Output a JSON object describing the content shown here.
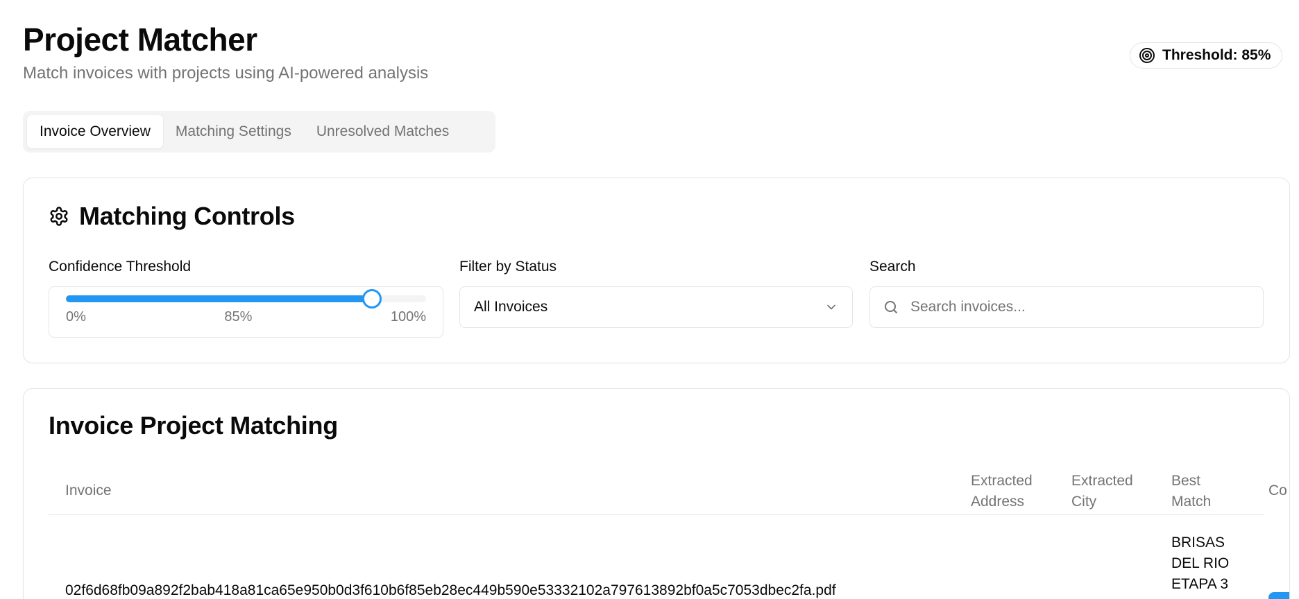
{
  "header": {
    "title": "Project Matcher",
    "subtitle": "Match invoices with projects using AI-powered analysis",
    "threshold_badge": "Threshold: 85%"
  },
  "tabs": [
    {
      "label": "Invoice Overview",
      "active": true
    },
    {
      "label": "Matching Settings",
      "active": false
    },
    {
      "label": "Unresolved Matches",
      "active": false
    }
  ],
  "controls": {
    "title": "Matching Controls",
    "confidence": {
      "label": "Confidence Threshold",
      "value": 85,
      "min_label": "0%",
      "value_label": "85%",
      "max_label": "100%"
    },
    "status_filter": {
      "label": "Filter by Status",
      "selected": "All Invoices"
    },
    "search": {
      "label": "Search",
      "placeholder": "Search invoices...",
      "value": ""
    }
  },
  "matching": {
    "title": "Invoice Project Matching",
    "columns": {
      "invoice": "Invoice",
      "address": "Extracted Address",
      "city": "Extracted City",
      "best_match": "Best Match",
      "confidence": "Co"
    },
    "rows": [
      {
        "invoice": "02f6d68fb09a892f2bab418a81ca65e950b0d3f610b6f85eb28ec449b590e53332102a797613892bf0a5c7053dbec2fa.pdf",
        "best_match": "BRISAS DEL RIO ETAPA 3"
      }
    ]
  },
  "colors": {
    "accent": "#2196f3",
    "muted_text": "#737373",
    "border": "#e5e5e5",
    "tab_bg": "#f4f4f5"
  },
  "icons": {
    "threshold": "target-icon",
    "controls": "gear-icon",
    "select": "chevron-down-icon",
    "search": "search-icon"
  }
}
